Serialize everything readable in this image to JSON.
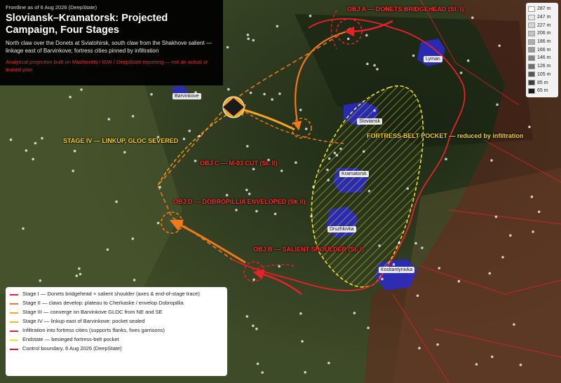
{
  "header": {
    "date": "Frontline as of 6 Aug 2026 (DeepState)",
    "title_line1": "Sloviansk–Kramatorsk: Projected",
    "title_line2": "Campaign, Four Stages",
    "subtitle": "North claw over the Donets at Sviatohirsk, south claw from the Shakhove salient — linkage east of Barvinkove; fortress cities pinned by infiltration",
    "warning": "Analytical projection built on Mashovets / ISW / DeepState reporting — not an actual or leaked plan"
  },
  "elevation_scale": {
    "steps": [
      {
        "label": "287 m",
        "color": "#ffffff"
      },
      {
        "label": "247 m",
        "color": "#e6e6e6"
      },
      {
        "label": "227 m",
        "color": "#d4d4d4"
      },
      {
        "label": "206 m",
        "color": "#c2c2c2"
      },
      {
        "label": "186 m",
        "color": "#aeaeae"
      },
      {
        "label": "166 m",
        "color": "#999999"
      },
      {
        "label": "146 m",
        "color": "#848484"
      },
      {
        "label": "126 m",
        "color": "#6e6e6e"
      },
      {
        "label": "105 m",
        "color": "#565656"
      },
      {
        "label": "85 m",
        "color": "#3c3c3c"
      },
      {
        "label": "65 m",
        "color": "#1a1a1a"
      }
    ]
  },
  "map_labels": {
    "obj_a": "OBJ A — DONETS BRIDGEHEAD (St. I)",
    "obj_b": "OBJ B — SALIENT SHOULDER (St. I)",
    "obj_c": "OBJ C — M-03 CUT (St. II)",
    "obj_d": "OBJ D — DOBROPILLIA ENVELOPED (St. II)",
    "stage4": "STAGE IV — LINKUP, GLOC SEVERED",
    "pocket": "FORTRESS-BELT POCKET — reduced by infiltration"
  },
  "cities": {
    "lyman": "Lyman",
    "barvinkove": "Barvinkove",
    "sloviansk": "Sloviansk",
    "kramatorsk": "Kramatorsk",
    "druzhkivka": "Druzhkivka",
    "kostiantynivka": "Kostiantynivka"
  },
  "legend": {
    "items": [
      {
        "label": "Stage I — Donets bridgehead + salient shoulder (axes & end-of-stage trace)",
        "color": "#e8202a"
      },
      {
        "label": "Stage II — claws develop: plateau to Cherkaske / envelop Dobropillia",
        "color": "#f07a1a"
      },
      {
        "label": "Stage III — converge on Barvinkove GLOC from NE and SE",
        "color": "#f5a623"
      },
      {
        "label": "Stage IV — linkup east of Barvinkove; pocket sealed",
        "color": "#e8c020"
      },
      {
        "label": "Infiltration into fortress cities (supports flanks, fixes garrisons)",
        "color": "#e8202a"
      },
      {
        "label": "Endstate — besieged fortress-belt pocket",
        "color": "#f2e21a"
      },
      {
        "label": "Control boundary, 6 Aug 2026 (DeepState)",
        "color": "#c0152a"
      }
    ]
  },
  "colors": {
    "stage1": "#e8202a",
    "stage2": "#f07a1a",
    "stage3": "#f5a623",
    "pocket": "#f2e21a",
    "control": "#c0152a",
    "urban": "#2a2acc"
  }
}
